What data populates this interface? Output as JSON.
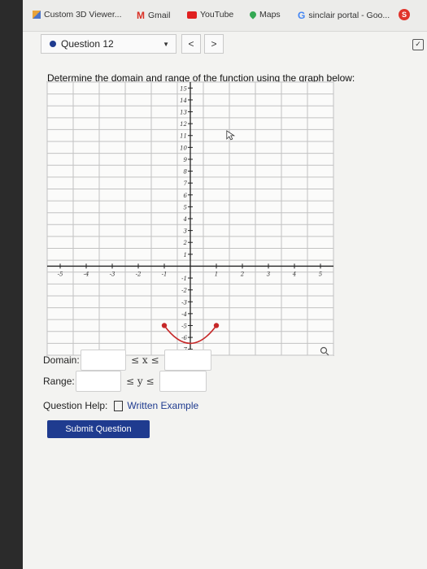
{
  "bookmarks": [
    {
      "label": "Custom 3D Viewer...",
      "icon": "bookmark-icon"
    },
    {
      "label": "Gmail",
      "icon": "gmail-icon"
    },
    {
      "label": "YouTube",
      "icon": "youtube-icon"
    },
    {
      "label": "Maps",
      "icon": "maps-icon"
    },
    {
      "label": "sinclair portal - Goo...",
      "icon": "google-icon"
    }
  ],
  "question_nav": {
    "label": "Question 12",
    "prev": "<",
    "next": ">"
  },
  "prompt": "Determine the domain and range of the function using the graph below:",
  "chart_data": {
    "type": "line",
    "x_ticks": [
      "-5",
      "-4",
      "-3",
      "-2",
      "-1",
      "1",
      "2",
      "3",
      "4",
      "5"
    ],
    "y_ticks": [
      "15",
      "14",
      "13",
      "12",
      "11",
      "10",
      "9",
      "8",
      "7",
      "6",
      "5",
      "4",
      "3",
      "2",
      "1",
      "-1",
      "-2",
      "-3",
      "-4",
      "-5",
      "-6",
      "-7"
    ],
    "xlim": [
      -5,
      5
    ],
    "ylim": [
      -7,
      15
    ],
    "series": [
      {
        "x": [
          -1,
          -0.5,
          0,
          0.5,
          1
        ],
        "y": [
          -5,
          -6.2,
          -6.5,
          -6.2,
          -5
        ],
        "color": "#c62828",
        "endpoints": "closed"
      }
    ],
    "grid": true
  },
  "form": {
    "domain_label": "Domain:",
    "range_label": "Range:",
    "domain_ineq": "≤ x ≤",
    "range_ineq": "≤ y ≤",
    "help_label": "Question Help:",
    "help_link": "Written Example",
    "submit_label": "Submit Question"
  }
}
